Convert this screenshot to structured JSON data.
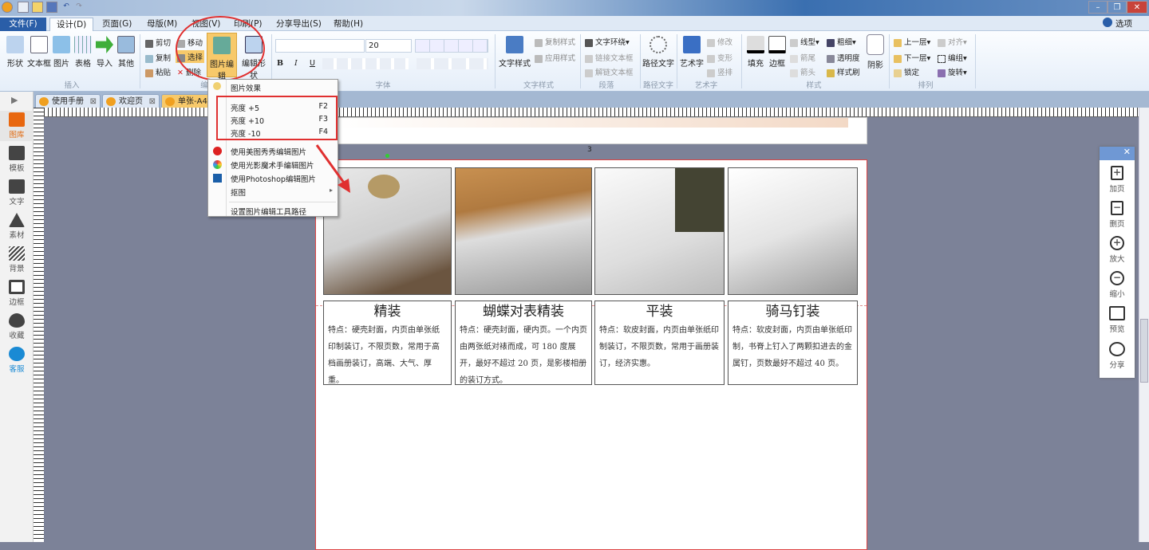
{
  "titlebar": {
    "window_controls": [
      "minimize",
      "restore",
      "close"
    ]
  },
  "menubar": {
    "tabs": [
      "文件(F)",
      "设计(D)",
      "页面(G)",
      "母版(M)",
      "视图(V)",
      "印刷(P)",
      "分享导出(S)",
      "帮助(H)"
    ],
    "active": "设计(D)",
    "options": "选项"
  },
  "ribbon": {
    "insert": {
      "items": [
        "形状",
        "文本框",
        "图片",
        "表格",
        "导入",
        "其他"
      ],
      "group": "插入"
    },
    "edit": {
      "cut": "剪切",
      "copy": "复制",
      "paste": "粘贴",
      "move": "移动",
      "select": "选择",
      "delete": "删除",
      "image_edit": "图片编辑",
      "edit_shape": "编辑形状",
      "group": "编"
    },
    "font": {
      "size": "20",
      "bold": "B",
      "italic": "I",
      "underline": "U",
      "group": "字体"
    },
    "text_style": {
      "main": "文字样式",
      "copy": "复制样式",
      "apply": "应用样式",
      "group": "文字样式"
    },
    "paragraph": {
      "wrap": "文字环绕",
      "link": "链接文本框",
      "unlink": "解链文本框",
      "group": "段落"
    },
    "path_text": {
      "main": "路径文字",
      "group": "路径文字"
    },
    "art": {
      "main": "艺术字",
      "modify": "修改",
      "transform": "变形",
      "vertical": "竖排",
      "group": "艺术字"
    },
    "style": {
      "fill": "填充",
      "border": "边框",
      "line": "线型",
      "thick": "粗细",
      "tail": "箭尾",
      "transparency": "透明度",
      "head": "箭头",
      "brush": "样式刷",
      "shadow": "阴影",
      "group": "样式"
    },
    "arrange": {
      "up": "上一层",
      "align": "对齐",
      "down": "下一层",
      "group_btn": "编组",
      "lock": "锁定",
      "rotate": "旋转",
      "group": "排列"
    }
  },
  "sidebar": {
    "items": [
      "图库",
      "模板",
      "文字",
      "素材",
      "背景",
      "边框",
      "收藏",
      "客服"
    ],
    "active": "图库"
  },
  "doc_tabs": [
    "使用手册",
    "欢迎页",
    "单张-A4双"
  ],
  "page_number": "3",
  "dropdown": {
    "header": "图片效果",
    "items": [
      {
        "label": "亮度 +5",
        "key": "F2"
      },
      {
        "label": "亮度 +10",
        "key": "F3"
      },
      {
        "label": "亮度 -10",
        "key": "F4"
      }
    ],
    "tools": [
      "使用美图秀秀编辑图片",
      "使用光影魔术手编辑图片",
      "使用Photoshop编辑图片"
    ],
    "cutout": "抠图",
    "settings": "设置图片编辑工具路径"
  },
  "cards": [
    {
      "title": "精装",
      "text": "特点：硬壳封面，内页由单张纸印制装订，不限页数，常用于高档画册装订，高端、大气、厚重。"
    },
    {
      "title": "蝴蝶对表精装",
      "text": "特点：硬壳封面，硬内页。一个内页由两张纸对裱而成，可 180 度展开，最好不超过 20 页，是影楼相册的装订方式。"
    },
    {
      "title": "平装",
      "text": "特点：软皮封面，内页由单张纸印制装订，不限页数，常用于画册装订，经济实惠。"
    },
    {
      "title": "骑马钉装",
      "text": "特点：软皮封面，内页由单张纸印制，书脊上钉入了两颗扣进去的金属钉，页数最好不超过 40 页。"
    }
  ],
  "right_panel": {
    "items": [
      "加页",
      "删页",
      "放大",
      "缩小",
      "预览",
      "分享"
    ]
  },
  "colors": {
    "highlight": "#e03030",
    "accent": "#f7c96a",
    "tab_blue": "#2a5ea8"
  }
}
